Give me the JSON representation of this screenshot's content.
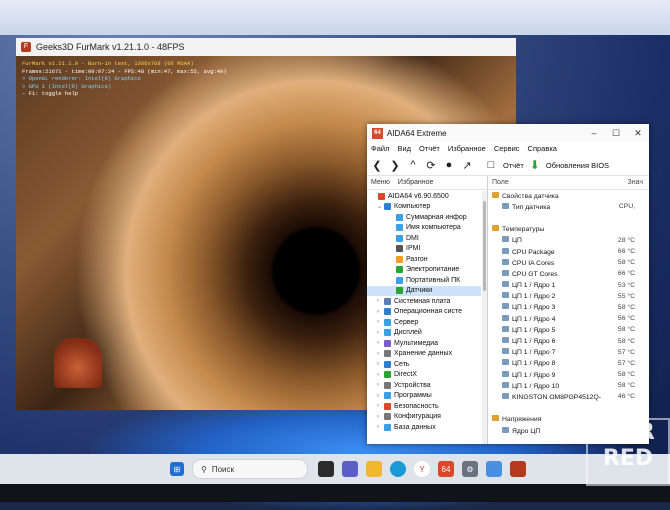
{
  "furmark": {
    "title": "Geeks3D FurMark v1.21.1.0 - 48FPS",
    "hud": [
      "FurMark v1.21.1.0 - Burn-in test, 1366x768 (0X MSAA)",
      "Frames:21671 - time:00:07:24 - FPS:48 (min:47, max:55, avg:49)",
      "> OpenGL renderer: Intel(R) Graphics",
      "> GPU 1 (Intel(R) Graphics)",
      "- F1: toggle help"
    ]
  },
  "aida": {
    "title": "AIDA64 Extreme",
    "menu": [
      "Файл",
      "Вид",
      "Отчёт",
      "Избранное",
      "Сервис",
      "Справка"
    ],
    "toolbar": {
      "report": "Отчёт",
      "bios": "Обновления BIOS"
    },
    "left_tabs": [
      "Меню",
      "Избранное"
    ],
    "tree": [
      {
        "label": "AIDA64 v6.90.6500",
        "indent": 0,
        "color": "#d9482b"
      },
      {
        "label": "Компьютер",
        "indent": 1,
        "color": "#2f7fd1"
      },
      {
        "label": "Суммарная инфор",
        "indent": 3,
        "color": "#3aa0e8"
      },
      {
        "label": "Имя компьютера",
        "indent": 3,
        "color": "#3aa0e8"
      },
      {
        "label": "DMI",
        "indent": 3,
        "color": "#3aa0e8"
      },
      {
        "label": "IPMI",
        "indent": 3,
        "color": "#555555"
      },
      {
        "label": "Разгон",
        "indent": 3,
        "color": "#f0a020"
      },
      {
        "label": "Электропитание",
        "indent": 3,
        "color": "#2aa334"
      },
      {
        "label": "Портативный ПК",
        "indent": 3,
        "color": "#3aa0e8"
      },
      {
        "label": "Датчики",
        "indent": 3,
        "color": "#2aa334",
        "selected": true
      },
      {
        "label": "Системная плата",
        "indent": 1,
        "color": "#5a7fb0"
      },
      {
        "label": "Операционная систе",
        "indent": 1,
        "color": "#2f7fd1"
      },
      {
        "label": "Сервер",
        "indent": 1,
        "color": "#3aa0e8"
      },
      {
        "label": "Дисплей",
        "indent": 1,
        "color": "#3aa0e8"
      },
      {
        "label": "Мультимедиа",
        "indent": 1,
        "color": "#7b5cc8"
      },
      {
        "label": "Хранение данных",
        "indent": 1,
        "color": "#777777"
      },
      {
        "label": "Сеть",
        "indent": 1,
        "color": "#2f7fd1"
      },
      {
        "label": "DirectX",
        "indent": 1,
        "color": "#2aa334"
      },
      {
        "label": "Устройства",
        "indent": 1,
        "color": "#777777"
      },
      {
        "label": "Программы",
        "indent": 1,
        "color": "#3aa0e8"
      },
      {
        "label": "Безопасность",
        "indent": 1,
        "color": "#d9482b"
      },
      {
        "label": "Конфигурация",
        "indent": 1,
        "color": "#777777"
      },
      {
        "label": "База данных",
        "indent": 1,
        "color": "#3aa0e8"
      }
    ],
    "right_header": {
      "field": "Поле",
      "value": "Знач"
    },
    "rows": [
      {
        "n": "Свойства датчика",
        "v": "",
        "lvl": 0,
        "group": true
      },
      {
        "n": "Тип датчика",
        "v": "CPU,",
        "lvl": 1
      },
      {
        "n": "",
        "v": "",
        "lvl": 0
      },
      {
        "n": "Температуры",
        "v": "",
        "lvl": 0,
        "group": true
      },
      {
        "n": "ЦП",
        "v": "28 °C",
        "lvl": 1
      },
      {
        "n": "CPU Package",
        "v": "66 °C",
        "lvl": 1
      },
      {
        "n": "CPU IA Cores",
        "v": "58 °C",
        "lvl": 1
      },
      {
        "n": "CPU GT Cores",
        "v": "66 °C",
        "lvl": 1
      },
      {
        "n": "ЦП 1 / Ядро 1",
        "v": "53 °C",
        "lvl": 1
      },
      {
        "n": "ЦП 1 / Ядро 2",
        "v": "55 °C",
        "lvl": 1
      },
      {
        "n": "ЦП 1 / Ядро 3",
        "v": "58 °C",
        "lvl": 1
      },
      {
        "n": "ЦП 1 / Ядро 4",
        "v": "56 °C",
        "lvl": 1
      },
      {
        "n": "ЦП 1 / Ядро 5",
        "v": "58 °C",
        "lvl": 1
      },
      {
        "n": "ЦП 1 / Ядро 6",
        "v": "58 °C",
        "lvl": 1
      },
      {
        "n": "ЦП 1 / Ядро 7",
        "v": "57 °C",
        "lvl": 1
      },
      {
        "n": "ЦП 1 / Ядро 8",
        "v": "57 °C",
        "lvl": 1
      },
      {
        "n": "ЦП 1 / Ядро 9",
        "v": "58 °C",
        "lvl": 1
      },
      {
        "n": "ЦП 1 / Ядро 10",
        "v": "58 °C",
        "lvl": 1
      },
      {
        "n": "KINGSTON OM8PGP4512Q-AA",
        "v": "46 °C",
        "lvl": 1
      },
      {
        "n": "",
        "v": "",
        "lvl": 0
      },
      {
        "n": "Напряжения",
        "v": "",
        "lvl": 0,
        "group": true
      },
      {
        "n": "Ядро ЦП",
        "v": "",
        "lvl": 1
      }
    ]
  },
  "taskbar": {
    "search_placeholder": "Поиск"
  },
  "watermark": [
    "DNR",
    "RED"
  ]
}
